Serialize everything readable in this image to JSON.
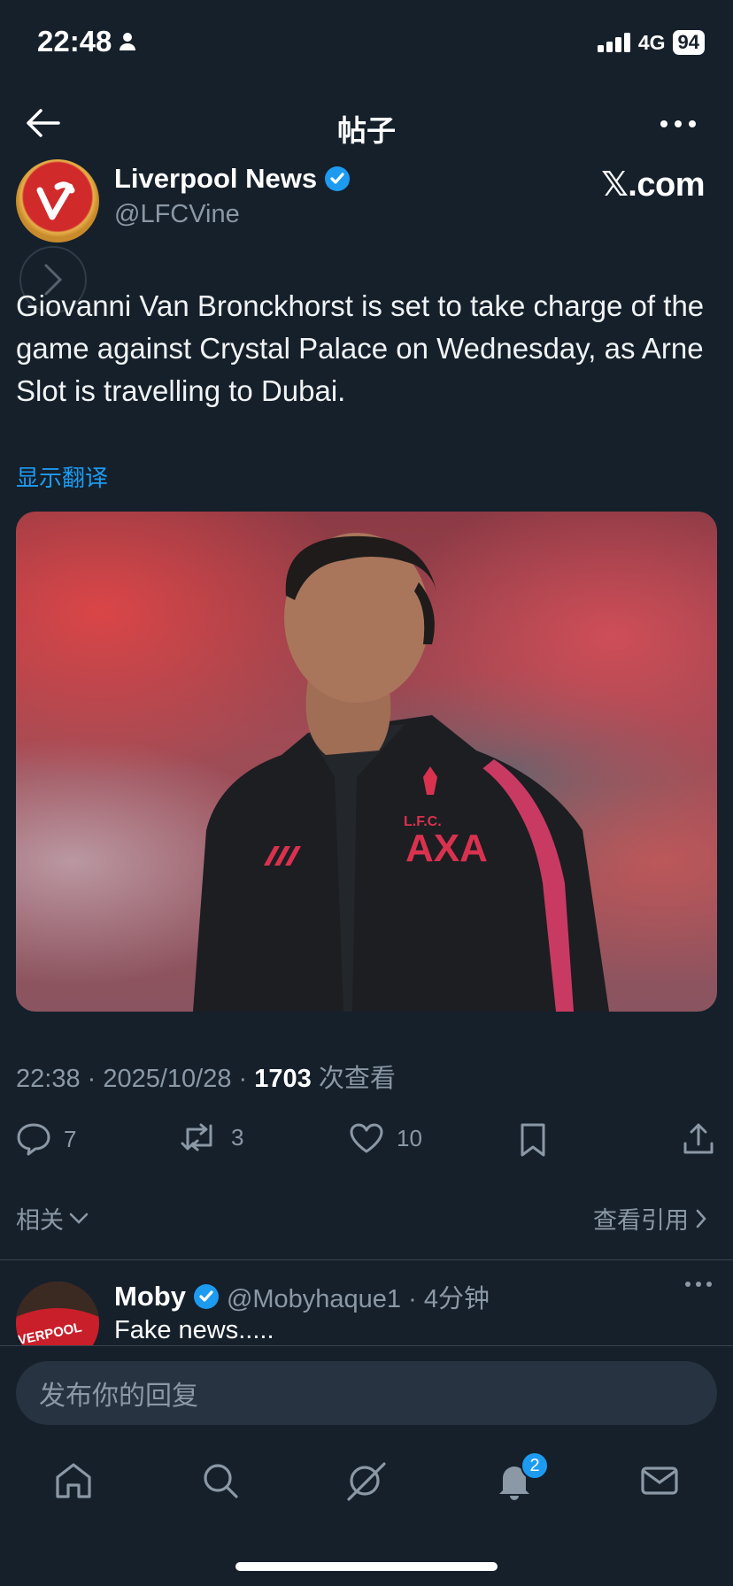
{
  "status": {
    "time": "22:48",
    "network": "4G",
    "battery": "94"
  },
  "nav": {
    "title": "帖子"
  },
  "post": {
    "author_name": "Liverpool News",
    "handle": "@LFCVine",
    "brand_watermark": "𝕏.com",
    "text": "Giovanni Van Bronckhorst is set to take charge of the game against Crystal Palace on Wednesday, as Arne Slot is travelling to Dubai.",
    "translate_label": "显示翻译",
    "timestamp": "22:38 · 2025/10/28 · ",
    "views": "1703",
    "views_label": " 次查看",
    "replies": "7",
    "reposts": "3",
    "likes": "10"
  },
  "related": {
    "label": "相关",
    "quotes_label": "查看引用"
  },
  "reply": {
    "name": "Moby",
    "handle": "@Mobyhaque1 · 4分钟",
    "text": "Fake news.....",
    "avatar_text": "VERPOOL F.C."
  },
  "composer": {
    "placeholder": "发布你的回复"
  },
  "tabbar": {
    "notifications_badge": "2"
  },
  "colors": {
    "accent": "#1d9bf0",
    "background": "#15202b",
    "muted": "#8b98a5"
  }
}
